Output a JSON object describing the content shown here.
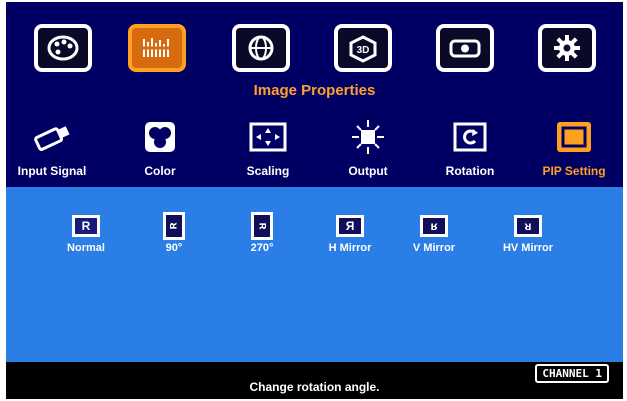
{
  "top_menu": {
    "items": [
      {
        "icon": "palette-icon"
      },
      {
        "icon": "image-properties-icon",
        "active": true
      },
      {
        "icon": "globe-icon"
      },
      {
        "icon": "3d-cube-icon"
      },
      {
        "icon": "projector-icon"
      },
      {
        "icon": "gear-icon"
      }
    ],
    "title": "Image Properties"
  },
  "sub_menu": {
    "items": [
      {
        "label": "Input Signal",
        "icon": "usb-plug-icon"
      },
      {
        "label": "Color",
        "icon": "color-circles-icon"
      },
      {
        "label": "Scaling",
        "icon": "scaling-arrows-icon"
      },
      {
        "label": "Output",
        "icon": "light-burst-icon"
      },
      {
        "label": "Rotation",
        "icon": "rotation-icon"
      },
      {
        "label": "PIP Setting",
        "icon": "pip-window-icon",
        "active": true
      }
    ]
  },
  "rotation_options": [
    {
      "label": "Normal",
      "glyph": "R",
      "selected": true
    },
    {
      "label": "90°",
      "glyph": "ᴚ"
    },
    {
      "label": "270°",
      "glyph": "ᴚ"
    },
    {
      "label": "H Mirror",
      "glyph": "Я"
    },
    {
      "label": "V Mirror",
      "glyph": "ʁ"
    },
    {
      "label": "HV Mirror",
      "glyph": "ᴚ"
    }
  ],
  "footer": {
    "status": "Change rotation angle.",
    "channel": "CHANNEL 1"
  },
  "colors": {
    "background": "#000064",
    "panel": "#2a7ee6",
    "accent": "#ffa020"
  }
}
